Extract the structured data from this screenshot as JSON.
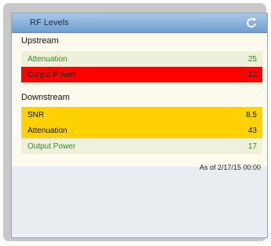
{
  "widget": {
    "title": "RF Levels",
    "refresh_icon": "refresh-icon"
  },
  "upstream": {
    "title": "Upstream",
    "rows": [
      {
        "label": "Attenuation",
        "value": "25",
        "status": "green"
      },
      {
        "label": "Output Power",
        "value": "12",
        "status": "red"
      }
    ]
  },
  "downstream": {
    "title": "Downstream",
    "rows": [
      {
        "label": "SNR",
        "value": "8.5",
        "status": "yellow"
      },
      {
        "label": "Attenuation",
        "value": "43",
        "status": "yellow"
      },
      {
        "label": "Output Power",
        "value": "17",
        "status": "green"
      }
    ]
  },
  "footer": {
    "as_of": "As of 2/17/15 00:00"
  },
  "colors": {
    "header_top": "#a9c7e8",
    "header_bottom": "#6f9ed0",
    "ok_text": "#2f8f1f",
    "alarm_red": "#ff0000",
    "warning_yellow": "#ffd200"
  }
}
